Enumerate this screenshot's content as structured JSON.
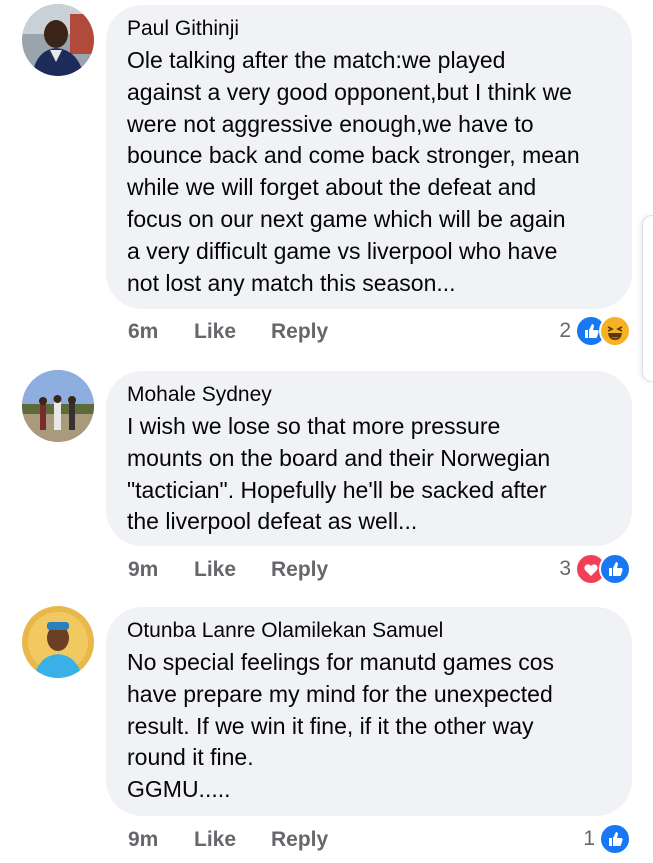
{
  "comments": [
    {
      "author": "Paul Githinji",
      "text": "Ole talking after the match:we played\nagainst a very good opponent,but I think we\nwere not aggressive enough,we have to\nbounce back and come back stronger, mean\nwhile we will forget about the defeat and\nfocus on our next game which will be again\na very difficult game vs liverpool who have\nnot lost any match this season...",
      "time": "6m",
      "like_label": "Like",
      "reply_label": "Reply",
      "reaction_count": "2",
      "reactions": [
        "like-icon",
        "haha-icon"
      ]
    },
    {
      "author": "Mohale Sydney",
      "text": "I wish we lose so that more pressure\nmounts on the board and their Norwegian\n\"tactician\". Hopefully he'll  be sacked after\nthe liverpool defeat as well...",
      "time": "9m",
      "like_label": "Like",
      "reply_label": "Reply",
      "reaction_count": "3",
      "reactions": [
        "love-icon",
        "like-icon"
      ]
    },
    {
      "author": "Otunba Lanre Olamilekan Samuel",
      "text": "No special feelings for manutd games cos\nhave prepare my mind for the unexpected\nresult. If we win it fine, if it the other way\nround it fine.\nGGMU.....",
      "time": "9m",
      "like_label": "Like",
      "reply_label": "Reply",
      "reaction_count": "1",
      "reactions": [
        "like-icon"
      ]
    }
  ],
  "colors": {
    "bubble": "#f0f2f5",
    "meta_text": "#65676b",
    "like_blue": "#1877f2",
    "love_red": "#f33e58",
    "haha_yellow": "#f7b125"
  }
}
